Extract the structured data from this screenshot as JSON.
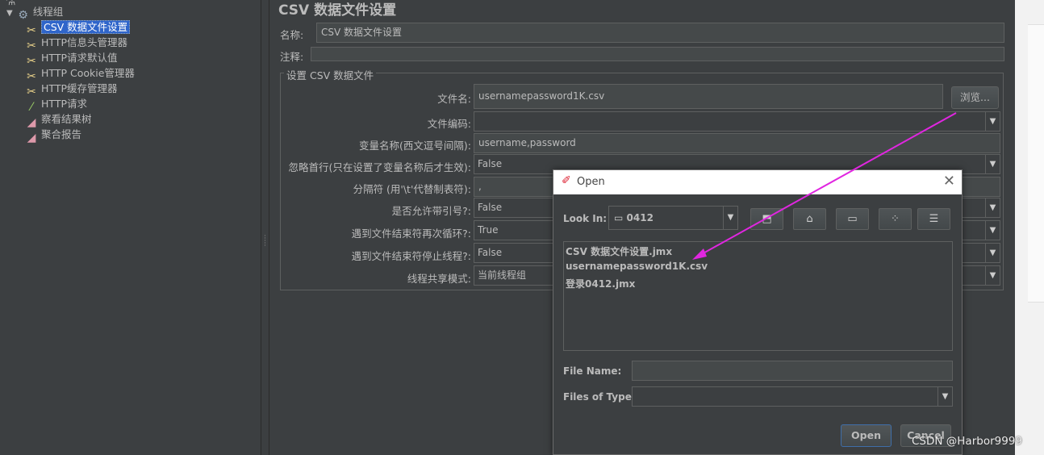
{
  "tree": {
    "items": [
      {
        "label": "线程组",
        "icon": "gear-icon"
      },
      {
        "label": "CSV 数据文件设置",
        "icon": "scissors-icon"
      },
      {
        "label": "HTTP信息头管理器",
        "icon": "scissors-icon"
      },
      {
        "label": "HTTP请求默认值",
        "icon": "scissors-icon"
      },
      {
        "label": "HTTP Cookie管理器",
        "icon": "scissors-icon"
      },
      {
        "label": "HTTP缓存管理器",
        "icon": "scissors-icon"
      },
      {
        "label": "HTTP请求",
        "icon": "pipette-icon"
      },
      {
        "label": "察看结果树",
        "icon": "chart-icon"
      },
      {
        "label": "聚合报告",
        "icon": "chart-icon"
      }
    ]
  },
  "panel": {
    "title": "CSV 数据文件设置",
    "name_label": "名称:",
    "name_value": "CSV 数据文件设置",
    "comment_label": "注释:",
    "group_title": "设置 CSV 数据文件",
    "filename_label": "文件名:",
    "filename_value": "usernamepassword1K.csv",
    "browse_label": "浏览...",
    "encoding_label": "文件编码:",
    "encoding_value": "",
    "varnames_label": "变量名称(西文逗号间隔):",
    "varnames_value": "username,password",
    "ignore_first_label": "忽略首行(只在设置了变量名称后才生效):",
    "ignore_first_value": "False",
    "delimiter_label": "分隔符 (用'\\t'代替制表符):",
    "delimiter_value": ",",
    "quoted_label": "是否允许带引号?:",
    "quoted_value": "False",
    "recycle_label": "遇到文件结束符再次循环?:",
    "recycle_value": "True",
    "stop_label": "遇到文件结束符停止线程?:",
    "stop_value": "False",
    "share_label": "线程共享模式:",
    "share_value": "当前线程组"
  },
  "dialog": {
    "title": "Open",
    "look_in_label": "Look In:",
    "look_in_value": "0412",
    "files": [
      "CSV 数据文件设置.jmx",
      "usernamepassword1K.csv",
      "登录0412.jmx"
    ],
    "file_name_label": "File Name:",
    "file_name_value": "",
    "file_type_label": "Files of Type:",
    "file_type_value": "",
    "open_label": "Open",
    "cancel_label": "Cancel"
  },
  "watermark": "CSDN @Harbor9999",
  "colors": {
    "annotation_arrow": "#e026e0",
    "selection": "#2f65ca"
  }
}
